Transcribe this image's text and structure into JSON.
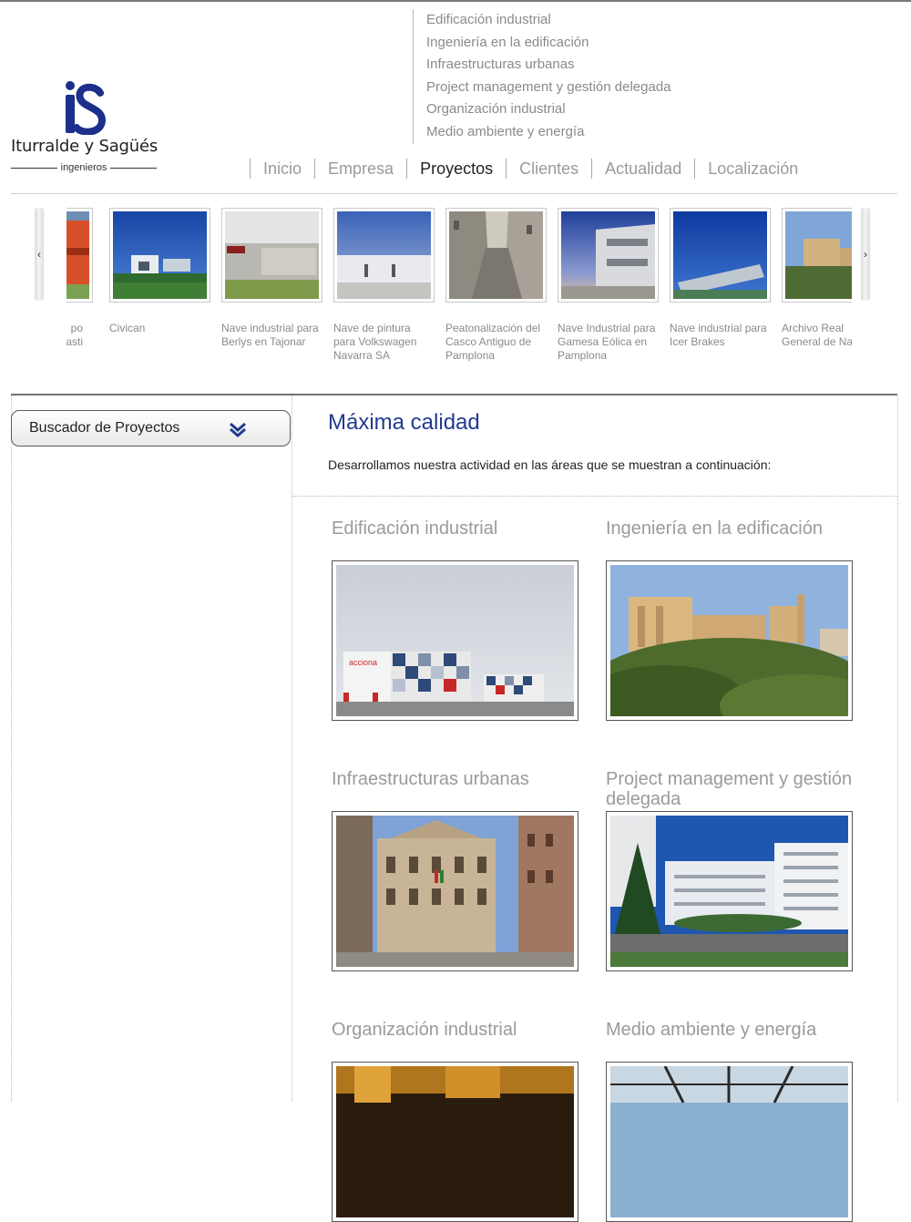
{
  "brand": {
    "logo_mark": "iS",
    "name": "Iturralde y Sagüés",
    "subtitle": "ingenieros"
  },
  "submenu": [
    "Edificación industrial",
    "Ingeniería en la edificación",
    "Infraestructuras urbanas",
    "Project management y gestión delegada",
    "Organización industrial",
    "Medio ambiente y energía"
  ],
  "nav": [
    {
      "label": "Inicio",
      "active": false
    },
    {
      "label": "Empresa",
      "active": false
    },
    {
      "label": "Proyectos",
      "active": true
    },
    {
      "label": "Clientes",
      "active": false
    },
    {
      "label": "Actualidad",
      "active": false
    },
    {
      "label": "Localización",
      "active": false
    }
  ],
  "carousel": {
    "prev_icon": "chevron-left-icon",
    "prev_glyph": "‹",
    "next_icon": "chevron-right-icon",
    "next_glyph": "›",
    "items": [
      {
        "caption": "...mpo\n...uasti",
        "partial": true
      },
      {
        "caption": "Civican"
      },
      {
        "caption": "Nave industrial para Berlys en Tajonar"
      },
      {
        "caption": "Nave de pintura para Volkswagen Navarra SA"
      },
      {
        "caption": "Peatonalización del Casco Antiguo de Pamplona"
      },
      {
        "caption": "Nave Industrial para Gamesa Eólica en Pamplona"
      },
      {
        "caption": "Nave industrial para Icer Brakes"
      },
      {
        "caption": "Archivo Real General de Navarra"
      }
    ]
  },
  "sidebar": {
    "search_label": "Buscador de Proyectos",
    "search_icon": "double-chevron-down-icon"
  },
  "main": {
    "title": "Máxima calidad",
    "intro": "Desarrollamos nuestra actividad en las áreas que se muestran a continuación:",
    "areas": [
      {
        "title": "Edificación industrial"
      },
      {
        "title": "Ingeniería en la edificación"
      },
      {
        "title": "Infraestructuras urbanas"
      },
      {
        "title": "Project management y gestión delegada"
      },
      {
        "title": "Organización industrial"
      },
      {
        "title": "Medio ambiente y energía"
      }
    ],
    "acciona_sign": "acciona"
  },
  "colors": {
    "title_blue": "#213a8f",
    "logo_blue": "#1c2f8a",
    "menu_grey": "#8a8a8a"
  }
}
